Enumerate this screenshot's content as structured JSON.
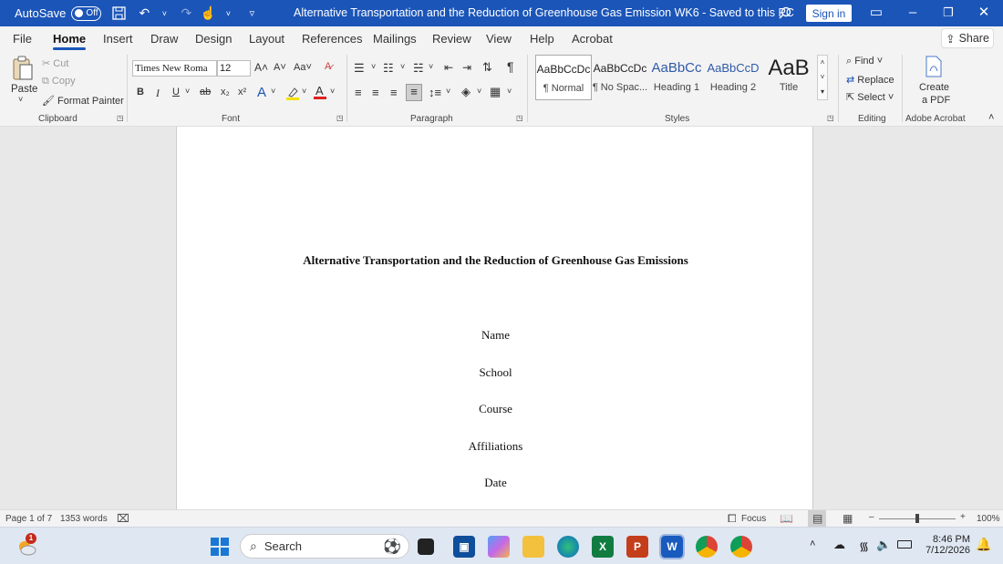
{
  "titlebar": {
    "autosave_label": "AutoSave",
    "autosave_state": "Off",
    "doc_title": "Alternative Transportation and the Reduction of Greenhouse Gas Emission WK6  -  Saved to this PC",
    "sign_in": "Sign in",
    "icons": [
      "save-icon",
      "undo-icon",
      "redo-icon",
      "touch-mode-icon",
      "customize-icon",
      "search-icon",
      "ribbon-display-icon",
      "minimize-icon",
      "maximize-icon",
      "close-icon"
    ]
  },
  "tabs": [
    "File",
    "Home",
    "Insert",
    "Draw",
    "Design",
    "Layout",
    "References",
    "Mailings",
    "Review",
    "View",
    "Help",
    "Acrobat"
  ],
  "active_tab": "Home",
  "share_label": "Share",
  "ribbon": {
    "clipboard": {
      "paste": "Paste",
      "cut": "Cut",
      "copy": "Copy",
      "format_painter": "Format Painter",
      "label": "Clipboard"
    },
    "font": {
      "family": "Times New Roma",
      "size": "12",
      "label": "Font",
      "case_label": "Aa",
      "bold": "B",
      "italic": "I",
      "underline": "U",
      "strike": "ab",
      "subscript": "x₂",
      "superscript": "x²"
    },
    "paragraph": {
      "label": "Paragraph"
    },
    "styles": {
      "label": "Styles",
      "items": [
        {
          "preview": "AaBbCcDc",
          "name": "¶ Normal"
        },
        {
          "preview": "AaBbCcDc",
          "name": "¶ No Spac..."
        },
        {
          "preview": "AaBbCc",
          "name": "Heading 1"
        },
        {
          "preview": "AaBbCcD",
          "name": "Heading 2"
        },
        {
          "preview": "AaB",
          "name": "Title"
        }
      ]
    },
    "editing": {
      "find": "Find",
      "replace": "Replace",
      "select": "Select",
      "label": "Editing"
    },
    "acrobat": {
      "create": "Create",
      "pdf": "a PDF",
      "label": "Adobe Acrobat"
    }
  },
  "document": {
    "title": "Alternative Transportation and the Reduction of Greenhouse Gas Emissions",
    "lines": [
      "Name",
      "School",
      "Course",
      "Affiliations",
      "Date"
    ]
  },
  "status": {
    "page": "Page 1 of 7",
    "words": "1353 words",
    "focus": "Focus",
    "zoom": "100%"
  },
  "taskbar": {
    "search_placeholder": "Search",
    "notification_count": "1",
    "time": "8:46 PM",
    "date": "7/12/2026",
    "apps": [
      "windows-start",
      "file-explorer",
      "store",
      "copilot",
      "folder",
      "edge",
      "excel",
      "powerpoint",
      "word",
      "chrome-w",
      "chrome-c"
    ]
  },
  "colors": {
    "accent": "#1b55b8",
    "word_blue": "#185abd",
    "excel_green": "#107c41",
    "ppt_red": "#c43e1c"
  }
}
